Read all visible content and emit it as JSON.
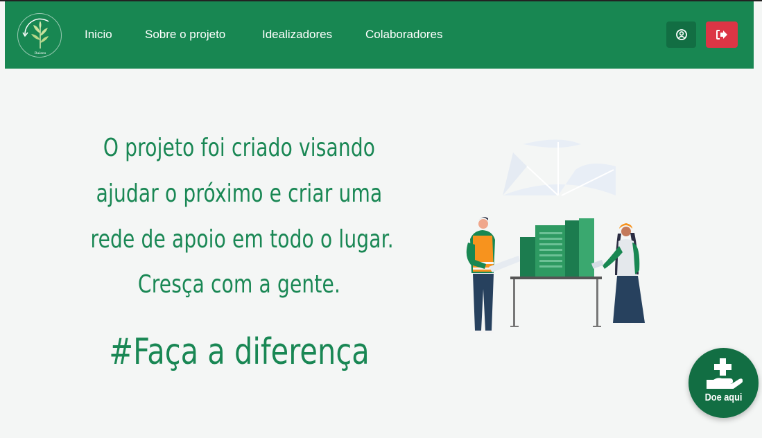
{
  "nav": {
    "links": [
      "Inicio",
      "Sobre o projeto",
      "Idealizadores",
      "Colaboradores"
    ]
  },
  "hero": {
    "lines": [
      "O projeto foi criado visando",
      "ajudar o próximo e criar uma",
      "rede de apoio em todo o lugar.",
      "Cresça com a gente."
    ],
    "hashtag": "#Faça a diferença"
  },
  "donate": {
    "label": "Doe aqui"
  },
  "icons": {
    "logo": "plant-logo-icon",
    "user": "user-circle-icon",
    "logout": "sign-out-icon",
    "donate": "hand-holding-medical-icon"
  },
  "colors": {
    "navbar": "#188752",
    "accent_text": "#198754",
    "user_button": "#126e43",
    "logout_button": "#dc3545",
    "background": "#f4f6f5"
  }
}
